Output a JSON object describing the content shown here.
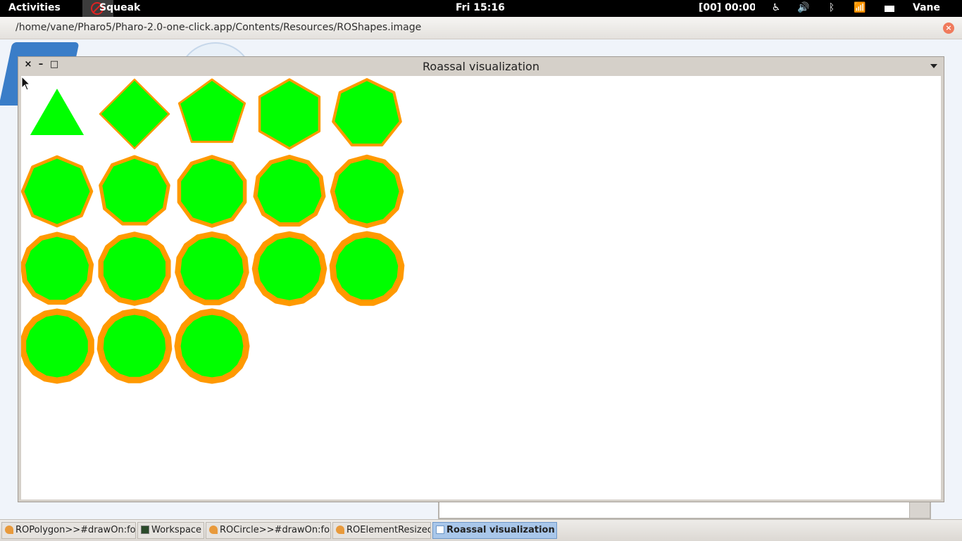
{
  "topbar": {
    "activities": "Activities",
    "app_name": "Squeak",
    "clock": "Fri 15:16",
    "timer": "[00] 00:00",
    "user": "Vane",
    "indicators": {
      "accessibility": "♿",
      "volume": "🔊",
      "bluetooth": "ᛒ",
      "wifi": "📶"
    }
  },
  "outer_window": {
    "path": "/home/vane/Pharo5/Pharo-2.0-one-click.app/Contents/Resources/ROShapes.image",
    "close": "×"
  },
  "roassal_window": {
    "title": "Roassal visualization",
    "close": "×",
    "minimize": "–",
    "maximize": "□",
    "shape_fill": "#00ff00",
    "shape_border": "#ff9900"
  },
  "taskbar": {
    "items": [
      {
        "label": "ROPolygon>>#drawOn:for:",
        "icon": "squeak-icon"
      },
      {
        "label": "Workspace",
        "icon": "workspace-icon"
      },
      {
        "label": "ROCircle>>#drawOn:for:",
        "icon": "squeak-icon"
      },
      {
        "label": "ROElementResized",
        "icon": "squeak-icon"
      },
      {
        "label": "Roassal visualization",
        "icon": "window-icon"
      }
    ]
  }
}
